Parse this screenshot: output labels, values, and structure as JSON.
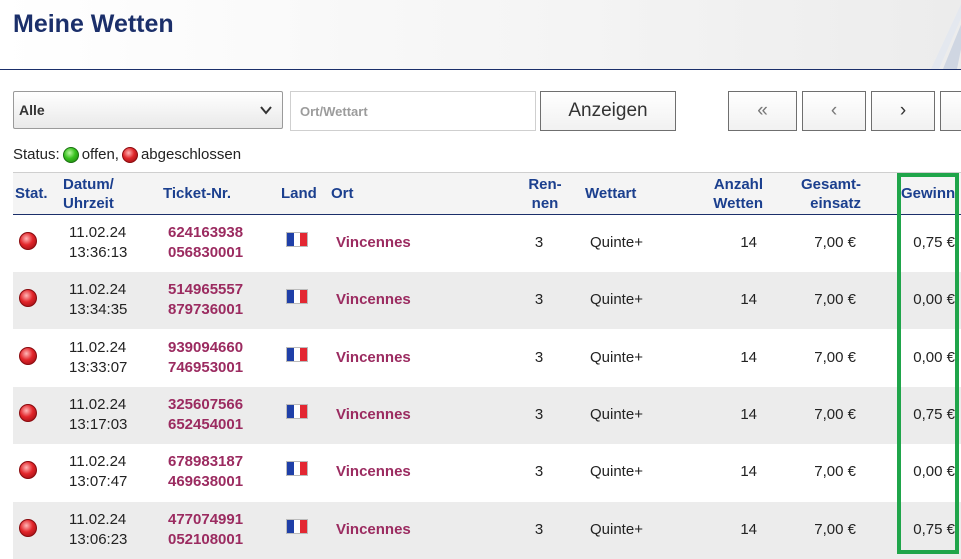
{
  "header": {
    "title": "Meine Wetten"
  },
  "filters": {
    "select_value": "Alle",
    "search_placeholder": "Ort/Wettart",
    "show_label": "Anzeigen"
  },
  "pager": {
    "first": "«",
    "prev": "‹",
    "next": "›"
  },
  "status_legend": {
    "prefix": "Status:",
    "open": "offen,",
    "closed": "abgeschlossen"
  },
  "columns": {
    "stat": "Stat.",
    "datum_1": "Datum/",
    "datum_2": "Uhrzeit",
    "ticket": "Ticket-Nr.",
    "land": "Land",
    "ort": "Ort",
    "rennen_1": "Ren-",
    "rennen_2": "nen",
    "wettart": "Wettart",
    "anzahl_1": "Anzahl",
    "anzahl_2": "Wetten",
    "einsatz_1": "Gesamt-",
    "einsatz_2": "einsatz",
    "gewinn": "Gewinn"
  },
  "colors": {
    "accent": "#1b2f6a",
    "link": "#9b2b60",
    "highlight": "#1fa54a"
  },
  "rows": [
    {
      "status": "abgeschlossen",
      "date": "11.02.24",
      "time": "13:36:13",
      "ticket_1": "624163938",
      "ticket_2": "056830001",
      "land": "flag-france-icon",
      "ort": "Vincennes",
      "rennen": "3",
      "wettart": "Quinte+",
      "anzahl": "14",
      "einsatz": "7,00 €",
      "gewinn": "0,75 €"
    },
    {
      "status": "abgeschlossen",
      "date": "11.02.24",
      "time": "13:34:35",
      "ticket_1": "514965557",
      "ticket_2": "879736001",
      "land": "flag-france-icon",
      "ort": "Vincennes",
      "rennen": "3",
      "wettart": "Quinte+",
      "anzahl": "14",
      "einsatz": "7,00 €",
      "gewinn": "0,00 €"
    },
    {
      "status": "abgeschlossen",
      "date": "11.02.24",
      "time": "13:33:07",
      "ticket_1": "939094660",
      "ticket_2": "746953001",
      "land": "flag-france-icon",
      "ort": "Vincennes",
      "rennen": "3",
      "wettart": "Quinte+",
      "anzahl": "14",
      "einsatz": "7,00 €",
      "gewinn": "0,00 €"
    },
    {
      "status": "abgeschlossen",
      "date": "11.02.24",
      "time": "13:17:03",
      "ticket_1": "325607566",
      "ticket_2": "652454001",
      "land": "flag-france-icon",
      "ort": "Vincennes",
      "rennen": "3",
      "wettart": "Quinte+",
      "anzahl": "14",
      "einsatz": "7,00 €",
      "gewinn": "0,75 €"
    },
    {
      "status": "abgeschlossen",
      "date": "11.02.24",
      "time": "13:07:47",
      "ticket_1": "678983187",
      "ticket_2": "469638001",
      "land": "flag-france-icon",
      "ort": "Vincennes",
      "rennen": "3",
      "wettart": "Quinte+",
      "anzahl": "14",
      "einsatz": "7,00 €",
      "gewinn": "0,00 €"
    },
    {
      "status": "abgeschlossen",
      "date": "11.02.24",
      "time": "13:06:23",
      "ticket_1": "477074991",
      "ticket_2": "052108001",
      "land": "flag-france-icon",
      "ort": "Vincennes",
      "rennen": "3",
      "wettart": "Quinte+",
      "anzahl": "14",
      "einsatz": "7,00 €",
      "gewinn": "0,75 €"
    }
  ]
}
